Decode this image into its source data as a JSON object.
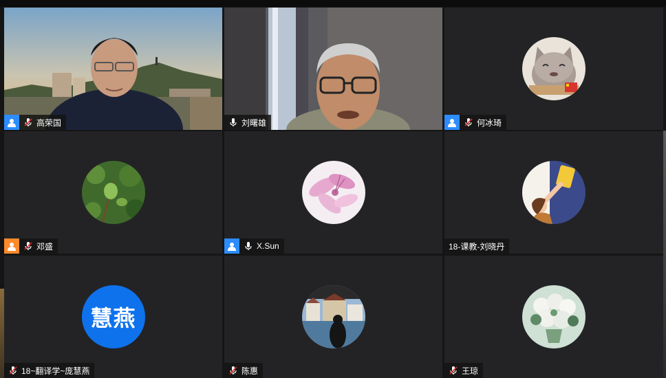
{
  "meeting": {
    "participants": [
      {
        "id": "p1",
        "name": "高荣国",
        "video_on": true,
        "mic": "muted",
        "host_badge": "blue",
        "speaking": false
      },
      {
        "id": "p2",
        "name": "刘曙雄",
        "video_on": true,
        "mic": "on",
        "host_badge": null,
        "speaking": true
      },
      {
        "id": "p3",
        "name": "何冰琦",
        "video_on": false,
        "mic": "muted",
        "host_badge": "blue",
        "speaking": false,
        "avatar": "cat-photo-icon"
      },
      {
        "id": "p4",
        "name": "邓盛",
        "video_on": false,
        "mic": "muted",
        "host_badge": "orange",
        "speaking": false,
        "avatar": "green-plant-photo-icon"
      },
      {
        "id": "p5",
        "name": "X.Sun",
        "video_on": false,
        "mic": "on",
        "host_badge": "blue",
        "speaking": false,
        "avatar": "pink-flower-photo-icon"
      },
      {
        "id": "p6",
        "name": "18-课教-刘晓丹",
        "video_on": false,
        "mic": null,
        "host_badge": null,
        "speaking": false,
        "avatar": "cartoon-girl-icon"
      },
      {
        "id": "p7",
        "name": "18~翻译学~庞慧燕",
        "video_on": false,
        "mic": "muted",
        "host_badge": null,
        "speaking": false,
        "avatar_text": "慧燕"
      },
      {
        "id": "p8",
        "name": "陈惠",
        "video_on": false,
        "mic": "muted",
        "host_badge": null,
        "speaking": false,
        "avatar": "lakeside-town-photo-icon"
      },
      {
        "id": "p9",
        "name": "王琼",
        "video_on": false,
        "mic": "muted",
        "host_badge": null,
        "speaking": false,
        "avatar": "flower-bouquet-photo-icon"
      }
    ]
  },
  "colors": {
    "tile_bg": "#232325",
    "speaking_border": "#5fd35f",
    "host_badge_blue": "#2d8cff",
    "host_badge_orange": "#ff8a2b",
    "avatar_text_bg": "#0e72ed",
    "muted_mic": "#e02828"
  }
}
